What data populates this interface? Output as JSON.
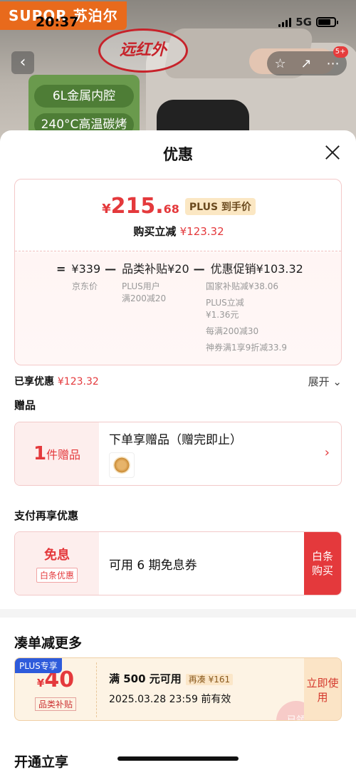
{
  "status_bar": {
    "time": "20:37",
    "network": "5G"
  },
  "brand": "SUPOR 苏泊尔",
  "logo_text": "远红外",
  "features": [
    "6L金属内腔",
    "240°C高温碳烤"
  ],
  "nav": {
    "message_badge": "5+"
  },
  "sheet": {
    "title": "优惠",
    "price": {
      "currency": "¥",
      "int": "215.",
      "dec": "68",
      "tag": "PLUS 到手价",
      "reduce_label": "购买立减",
      "reduce_amount": "¥123.32"
    },
    "formula": {
      "eq": "=",
      "base": "¥339",
      "minus1": "—",
      "subsidy": "品类补贴¥20",
      "minus2": "—",
      "promo": "优惠促销¥103.32"
    },
    "details": {
      "base_label": "京东价",
      "subsidy_desc": [
        "PLUS用户",
        "满200减20"
      ],
      "promo_items": [
        "国家补贴减¥38.06",
        "PLUS立减",
        "¥1.36元",
        "每满200减30",
        "神券满1享9折减33.9"
      ]
    },
    "enjoyed": {
      "label": "已享优惠",
      "amount": "¥123.32",
      "expand": "展开"
    },
    "gift_section": {
      "label": "赠品",
      "count": "1",
      "count_unit": "件赠品",
      "title": "下单享赠品（赠完即止）"
    },
    "pay_section": {
      "label": "支付再享优惠",
      "left_title": "免息",
      "left_badge": "白条优惠",
      "desc": "可用 6 期免息券",
      "button": "白条购买"
    },
    "coupon_section": {
      "label": "凑单减更多",
      "ribbon": "PLUS专享",
      "currency": "¥",
      "value": "40",
      "tag": "品类补贴",
      "condition": "满 500 元可用",
      "extra": "再凑 ¥161",
      "valid": "2025.03.28 23:59 前有效",
      "button": "立即使用",
      "stamp": "已领"
    },
    "next_section": "开通立享"
  }
}
